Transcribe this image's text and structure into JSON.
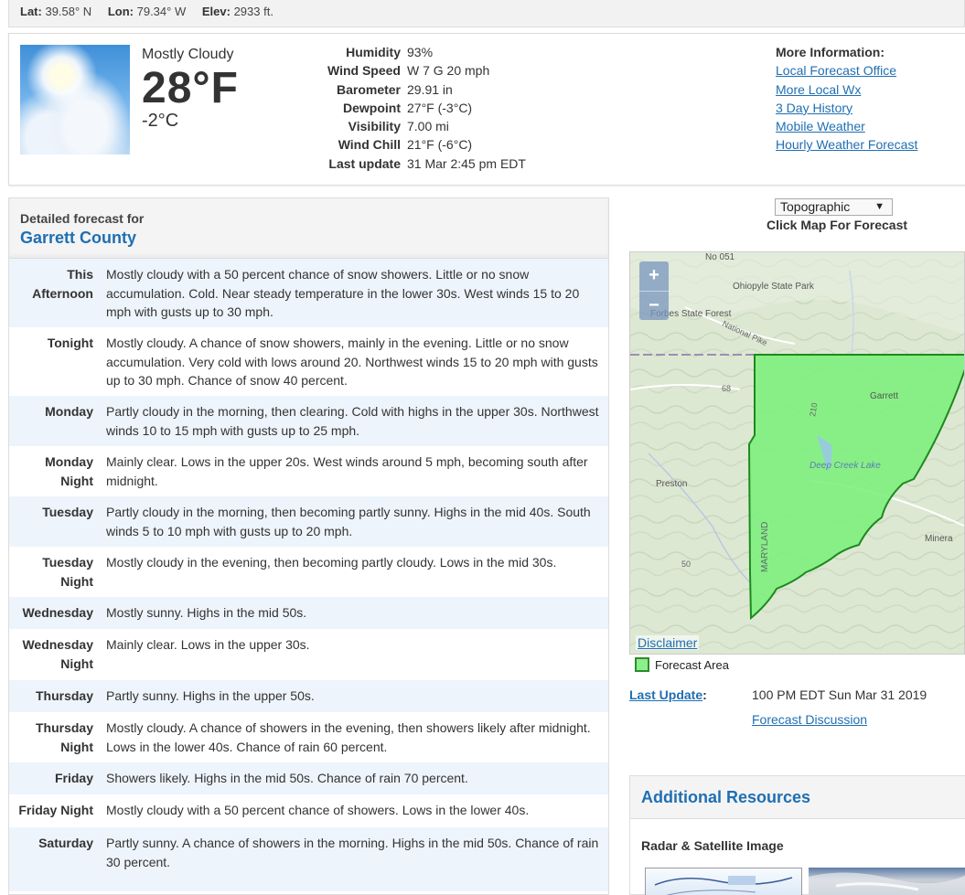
{
  "location_bar": {
    "lat_label": "Lat:",
    "lat_value": "39.58° N",
    "lon_label": "Lon:",
    "lon_value": "79.34° W",
    "elev_label": "Elev:",
    "elev_value": "2933 ft."
  },
  "current": {
    "condition": "Mostly Cloudy",
    "temp_f": "28°F",
    "temp_c": "-2°C",
    "icon": "mostly-cloudy-icon",
    "details": [
      {
        "label": "Humidity",
        "value": "93%"
      },
      {
        "label": "Wind Speed",
        "value": "W 7 G 20 mph"
      },
      {
        "label": "Barometer",
        "value": "29.91 in"
      },
      {
        "label": "Dewpoint",
        "value": "27°F (-3°C)"
      },
      {
        "label": "Visibility",
        "value": "7.00 mi"
      },
      {
        "label": "Wind Chill",
        "value": "21°F (-6°C)"
      },
      {
        "label": "Last update",
        "value": "31 Mar 2:45 pm EDT"
      }
    ],
    "more_info": {
      "heading": "More Information:",
      "links": [
        "Local Forecast Office",
        "More Local Wx",
        "3 Day History",
        "Mobile Weather",
        "Hourly Weather Forecast"
      ]
    }
  },
  "forecast": {
    "heading": "Detailed forecast for",
    "area": "Garrett County",
    "periods": [
      {
        "name": "This Afternoon",
        "text": "Mostly cloudy with a 50 percent chance of snow showers. Little or no snow accumulation. Cold. Near steady temperature in the lower 30s. West winds 15 to 20 mph with gusts up to 30 mph."
      },
      {
        "name": "Tonight",
        "text": "Mostly cloudy. A chance of snow showers, mainly in the evening. Little or no snow accumulation. Very cold with lows around 20. Northwest winds 15 to 20 mph with gusts up to 30 mph. Chance of snow 40 percent."
      },
      {
        "name": "Monday",
        "text": "Partly cloudy in the morning, then clearing. Cold with highs in the upper 30s. Northwest winds 10 to 15 mph with gusts up to 25 mph."
      },
      {
        "name": "Monday Night",
        "text": "Mainly clear. Lows in the upper 20s. West winds around 5 mph, becoming south after midnight."
      },
      {
        "name": "Tuesday",
        "text": "Partly cloudy in the morning, then becoming partly sunny. Highs in the mid 40s. South winds 5 to 10 mph with gusts up to 20 mph."
      },
      {
        "name": "Tuesday Night",
        "text": "Mostly cloudy in the evening, then becoming partly cloudy. Lows in the mid 30s."
      },
      {
        "name": "Wednesday",
        "text": "Mostly sunny. Highs in the mid 50s."
      },
      {
        "name": "Wednesday Night",
        "text": "Mainly clear. Lows in the upper 30s."
      },
      {
        "name": "Thursday",
        "text": "Partly sunny. Highs in the upper 50s."
      },
      {
        "name": "Thursday Night",
        "text": "Mostly cloudy. A chance of showers in the evening, then showers likely after midnight. Lows in the lower 40s. Chance of rain 60 percent."
      },
      {
        "name": "Friday",
        "text": "Showers likely. Highs in the mid 50s. Chance of rain 70 percent."
      },
      {
        "name": "Friday Night",
        "text": "Mostly cloudy with a 50 percent chance of showers. Lows in the lower 40s."
      },
      {
        "name": "Saturday",
        "text": "Partly sunny. A chance of showers in the morning. Highs in the mid 50s. Chance of rain 30 percent."
      }
    ]
  },
  "map": {
    "type_selected": "Topographic",
    "click_hint": "Click Map For Forecast",
    "zoom_in": "+",
    "zoom_out": "−",
    "disclaimer": "Disclaimer",
    "legend": "Forecast Area",
    "labels": [
      "No 051",
      "Ohiopyle State Park",
      "Forbes State Forest",
      "National Pike",
      "68",
      "Garrett",
      "210",
      "Deep Creek Lake",
      "Preston",
      "MARYLAND",
      "Minera",
      "50"
    ],
    "forecast_area_color": "#7ef07e"
  },
  "update": {
    "label": "Last Update",
    "colon": ":",
    "value": "100 PM EDT Sun Mar 31 2019",
    "discussion": "Forecast Discussion"
  },
  "resources": {
    "heading": "Additional Resources",
    "radar": "Radar & Satellite Image"
  }
}
